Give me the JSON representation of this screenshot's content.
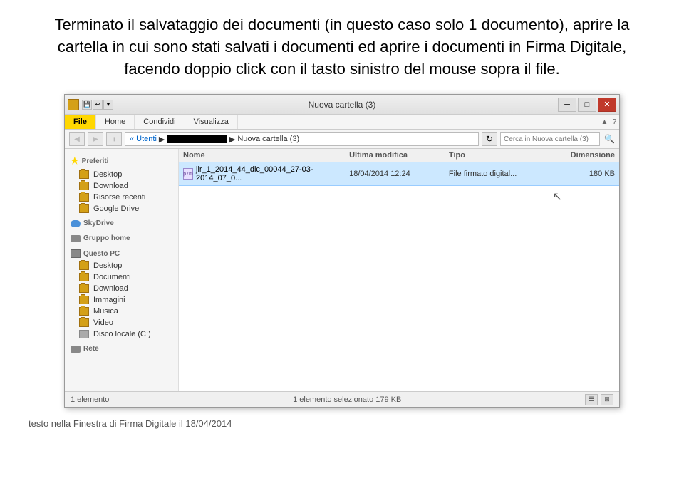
{
  "instruction": {
    "text": "Terminato il salvataggio dei documenti (in questo caso solo 1 documento), aprire la cartella in cui sono stati salvati i documenti ed aprire i documenti in Firma Digitale, facendo doppio click con il tasto sinistro del mouse sopra il file."
  },
  "titlebar": {
    "title": "Nuova cartella (3)",
    "minimize": "─",
    "maximize": "□",
    "close": "✕"
  },
  "ribbon": {
    "tabs": [
      "File",
      "Home",
      "Condividi",
      "Visualizza"
    ]
  },
  "addressbar": {
    "back": "◀",
    "forward": "▶",
    "up": "↑",
    "path": "« Utenti  ▶  Nuova cartella (3)",
    "refresh": "↻",
    "search_placeholder": "Cerca in Nuova cartella (3)"
  },
  "sidebar": {
    "sections": [
      {
        "header": "Preferiti",
        "items": [
          "Desktop",
          "Download",
          "Risorse recenti",
          "Google Drive"
        ]
      },
      {
        "header": "SkyDrive",
        "items": []
      },
      {
        "header": "Gruppo home",
        "items": []
      },
      {
        "header": "Questo PC",
        "items": [
          "Desktop",
          "Documenti",
          "Download",
          "Immagini",
          "Musica",
          "Video",
          "Disco locale (C:)"
        ]
      },
      {
        "header": "Rete",
        "items": []
      }
    ]
  },
  "columns": {
    "name": "Nome",
    "date": "Ultima modifica",
    "type": "Tipo",
    "size": "Dimensione"
  },
  "files": [
    {
      "name": "jir_1_2014_44_dlc_00044_27-03-2014_07_0...",
      "date": "18/04/2014 12:24",
      "type": "File firmato digital...",
      "size": "180 KB"
    }
  ],
  "statusbar": {
    "items": "1 elemento",
    "selected": "1 elemento selezionato  179 KB"
  },
  "bottom_text": "testo nella Finestra di Firma Digitale il 18/04/2014"
}
